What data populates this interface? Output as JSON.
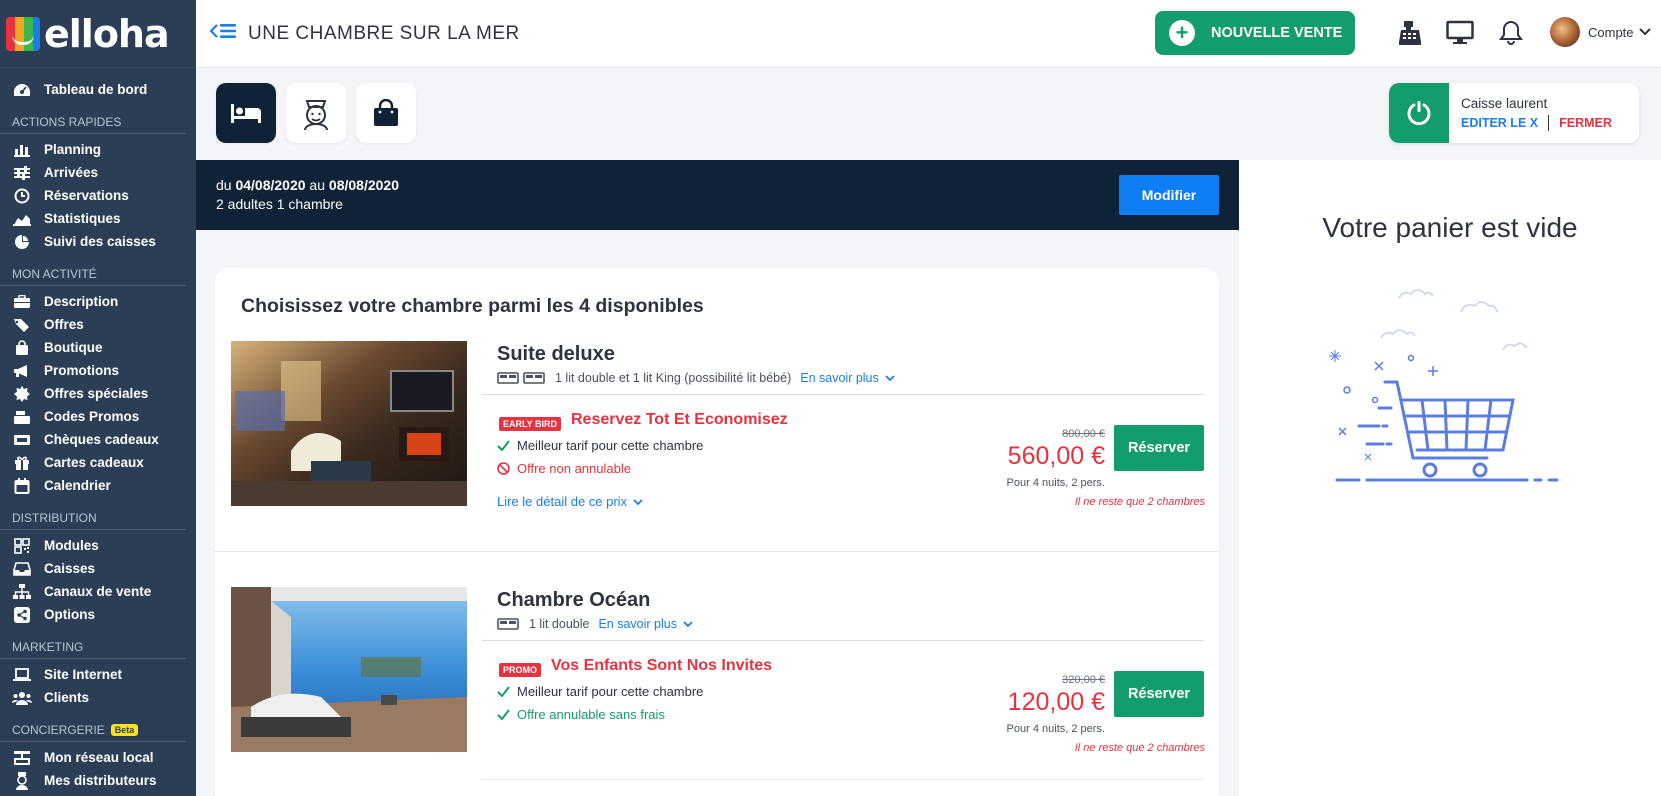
{
  "logo": {
    "text": "elloha",
    "colors": [
      "#e8323f",
      "#f6a623",
      "#3cb64a",
      "#1b7ee6"
    ]
  },
  "sidebar": {
    "dashboard": "Tableau de bord",
    "sections": [
      {
        "title": "ACTIONS RAPIDES",
        "items": [
          {
            "label": "Planning",
            "icon": "bar-chart-icon"
          },
          {
            "label": "Arrivées",
            "icon": "sliders-icon"
          },
          {
            "label": "Réservations",
            "icon": "clock-icon"
          },
          {
            "label": "Statistiques",
            "icon": "area-chart-icon"
          },
          {
            "label": "Suivi des caisses",
            "icon": "pie-chart-icon"
          }
        ]
      },
      {
        "title": "MON ACTIVITÉ",
        "items": [
          {
            "label": "Description",
            "icon": "briefcase-icon"
          },
          {
            "label": "Offres",
            "icon": "tags-icon"
          },
          {
            "label": "Boutique",
            "icon": "shopping-bag-icon"
          },
          {
            "label": "Promotions",
            "icon": "bullhorn-icon"
          },
          {
            "label": "Offres spéciales",
            "icon": "burst-icon"
          },
          {
            "label": "Codes Promos",
            "icon": "cash-register-icon"
          },
          {
            "label": "Chèques cadeaux",
            "icon": "ticket-icon"
          },
          {
            "label": "Cartes cadeaux",
            "icon": "gift-icon"
          },
          {
            "label": "Calendrier",
            "icon": "calendar-icon"
          }
        ]
      },
      {
        "title": "DISTRIBUTION",
        "items": [
          {
            "label": "Modules",
            "icon": "qrcode-icon"
          },
          {
            "label": "Caisses",
            "icon": "inbox-icon"
          },
          {
            "label": "Canaux de vente",
            "icon": "sitemap-icon"
          },
          {
            "label": "Options",
            "icon": "share-icon"
          }
        ]
      },
      {
        "title": "MARKETING",
        "items": [
          {
            "label": "Site Internet",
            "icon": "laptop-icon"
          },
          {
            "label": "Clients",
            "icon": "users-icon"
          }
        ]
      },
      {
        "title": "CONCIERGERIE",
        "badge": "Beta",
        "items": [
          {
            "label": "Mon réseau local",
            "icon": "network-icon"
          },
          {
            "label": "Mes distributeurs",
            "icon": "concierge-icon"
          }
        ]
      }
    ]
  },
  "header": {
    "title": "UNE CHAMBRE SUR LA MER",
    "new_sale": "NOUVELLE VENTE",
    "account": "Compte"
  },
  "register": {
    "name": "Caisse laurent",
    "edit": "EDITER LE X",
    "close": "FERMER"
  },
  "search": {
    "dates_prefix": "du ",
    "date_from": "04/08/2020",
    "dates_mid": " au ",
    "date_to": "08/08/2020",
    "guests": "2 adultes 1 chambre",
    "modify": "Modifier"
  },
  "cart": {
    "empty": "Votre panier est vide"
  },
  "rooms": {
    "title": "Choisissez votre chambre parmi les 4 disponibles",
    "list": [
      {
        "name": "Suite deluxe",
        "beds": "1 lit double et 1 lit King (possibilité lit bébé)",
        "more": "En savoir plus",
        "badge": "EARLY BIRD",
        "offer": "Reservez Tot Et Economisez",
        "feature1": "Meilleur tarif pour cette chambre",
        "feature2": "Offre non annulable",
        "detail": "Lire le détail de ce prix",
        "old_price": "800,00 €",
        "price": "560,00 €",
        "per": "Pour 4 nuits, 2 pers.",
        "remaining": "Il ne reste que 2 chambres",
        "book": "Réserver"
      },
      {
        "name": "Chambre Océan",
        "beds": "1 lit double",
        "more": "En savoir plus",
        "badge": "PROMO",
        "offer": "Vos Enfants Sont Nos Invites",
        "feature1": "Meilleur tarif pour cette chambre",
        "feature2": "Offre annulable sans frais",
        "old_price": "320,00 €",
        "price": "120,00 €",
        "per": "Pour 4 nuits, 2 pers.",
        "remaining": "Il ne reste que 2 chambres",
        "book": "Réserver"
      }
    ]
  }
}
